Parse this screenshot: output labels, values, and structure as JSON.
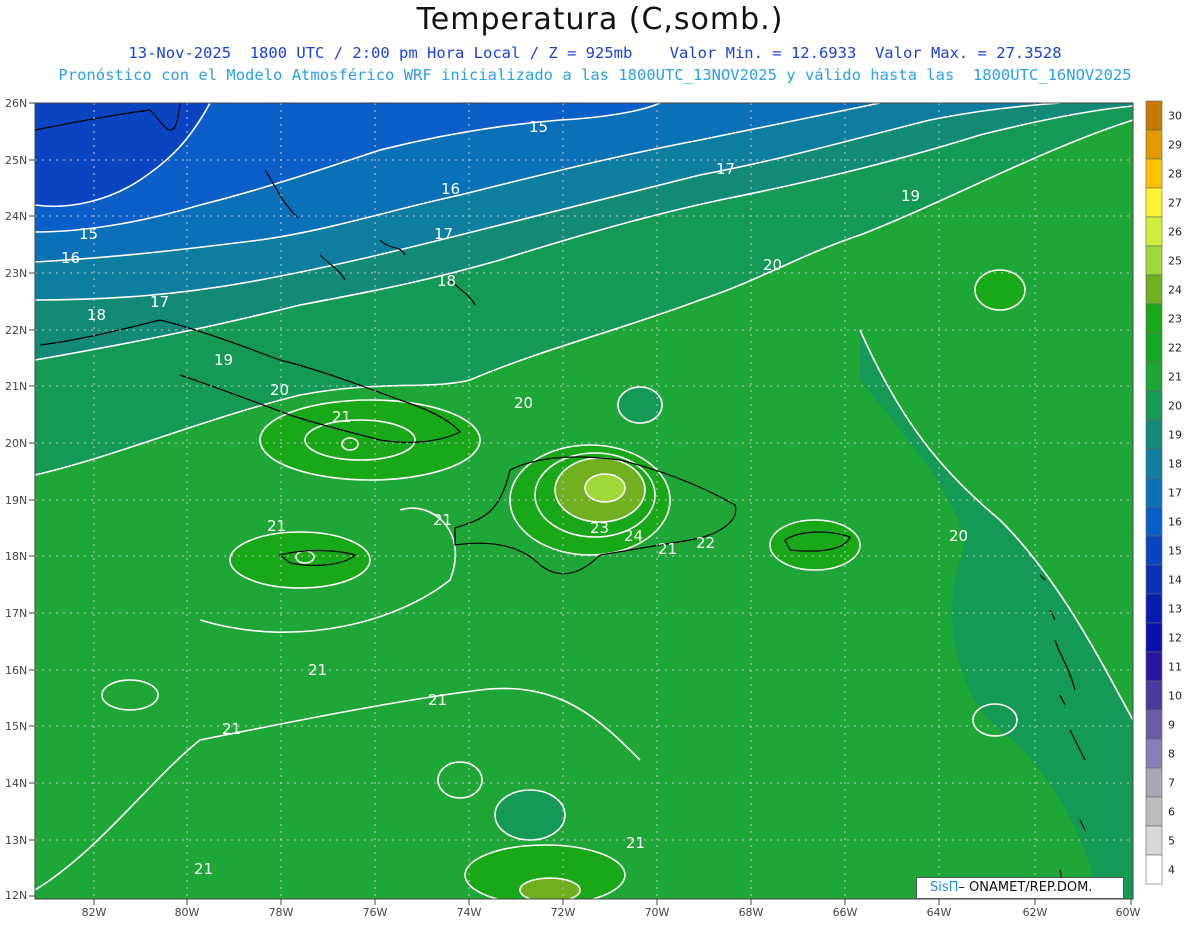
{
  "title": "Temperatura (C,somb.)",
  "subtitle_line1": "13-Nov-2025  1800 UTC / 2:00 pm Hora Local / Z = 925mb    Valor Min. = 12.6933  Valor Max. = 27.3528",
  "subtitle_line2": "Pronóstico con el Modelo Atmosférico WRF inicializado a las 1800UTC_13NOV2025 y válido hasta las  1800UTC_16NOV2025",
  "credit": {
    "brand": "SisΠ",
    "text": "– ONAMET/REP.DOM."
  },
  "lat_labels": [
    "26N",
    "25N",
    "24N",
    "23N",
    "22N",
    "21N",
    "20N",
    "19N",
    "18N",
    "17N",
    "16N",
    "15N",
    "14N",
    "13N",
    "12N"
  ],
  "lon_labels": [
    "82W",
    "80W",
    "78W",
    "76W",
    "74W",
    "72W",
    "70W",
    "68W",
    "66W",
    "64W",
    "62W",
    "60W"
  ],
  "contour_labels": [
    "15",
    "17",
    "19",
    "16",
    "17",
    "15",
    "16",
    "18",
    "17",
    "18",
    "19",
    "20",
    "20",
    "20",
    "21",
    "21",
    "21",
    "22",
    "23",
    "24",
    "21",
    "20",
    "21",
    "21",
    "21",
    "21",
    "21"
  ],
  "colorbar": {
    "labels": [
      "30",
      "29",
      "28",
      "27",
      "26",
      "25",
      "24",
      "23",
      "22",
      "21",
      "20",
      "19",
      "18",
      "17",
      "16",
      "15",
      "14",
      "13",
      "12",
      "11",
      "10",
      "9",
      "8",
      "7",
      "6",
      "5",
      "4"
    ],
    "colors": [
      "#c47c00",
      "#e29a00",
      "#ffc000",
      "#fff230",
      "#cfee36",
      "#9fd838",
      "#70b020",
      "#18a818",
      "#14a826",
      "#1ea636",
      "#159a56",
      "#128a76",
      "#0e7ea0",
      "#0a70b8",
      "#0a5ec8",
      "#0a44c0",
      "#0a30b8",
      "#0a1cb0",
      "#0a10a8",
      "#2818a0",
      "#4a3aa0",
      "#6a5aa8",
      "#8a7eb8",
      "#a8a8b4",
      "#bcbcbc",
      "#d8d8d8",
      "#ffffff"
    ]
  },
  "colors": {
    "land_outline": "#000000",
    "contour": "#ffffff",
    "grid": "#9a9aa0"
  }
}
